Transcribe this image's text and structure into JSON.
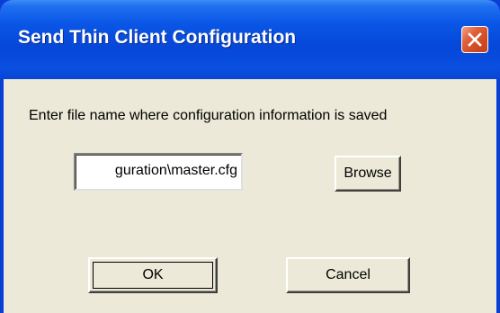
{
  "window": {
    "title": "Send Thin Client Configuration",
    "close_icon": "close-icon"
  },
  "dialog": {
    "prompt": "Enter file name where configuration information is saved",
    "file_field": {
      "value": "guration\\master.cfg"
    },
    "browse_label": "Browse",
    "ok_label": "OK",
    "cancel_label": "Cancel"
  },
  "colors": {
    "titlebar": "#0a56e6",
    "client_background": "#ece9d8",
    "close_button": "#d9552c"
  }
}
